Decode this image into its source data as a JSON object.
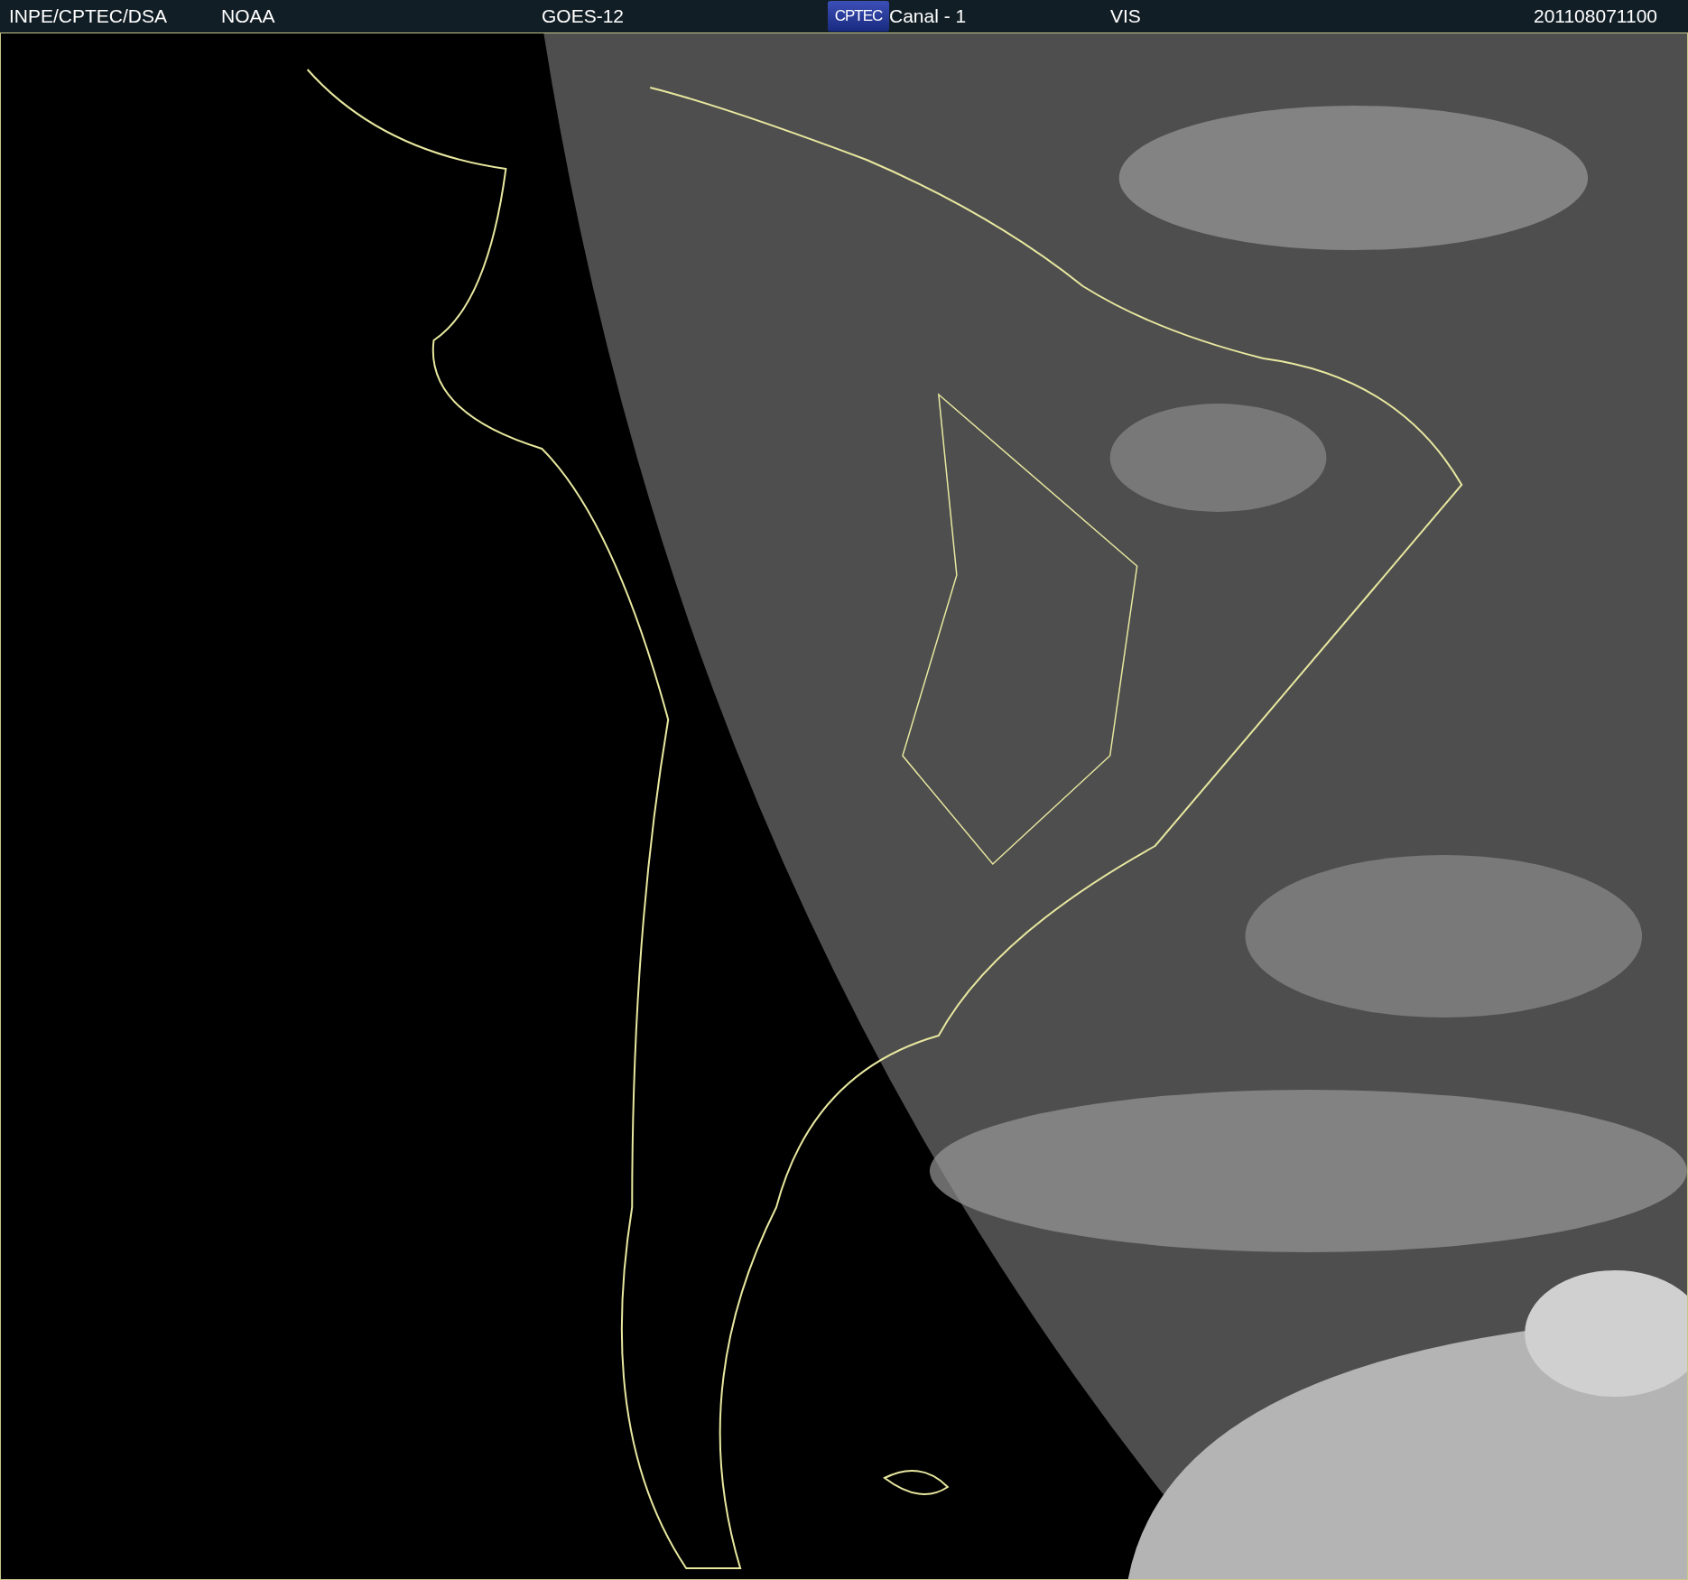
{
  "header": {
    "items": [
      {
        "kind": "text",
        "text": "INPE/CPTEC/DSA"
      },
      {
        "kind": "text",
        "text": "NOAA"
      },
      {
        "kind": "text",
        "text": "GOES-12"
      },
      {
        "kind": "logo",
        "text": "CPTEC"
      },
      {
        "kind": "text",
        "text": "Canal - 1"
      },
      {
        "kind": "text",
        "text": "VIS"
      },
      {
        "kind": "text",
        "text": "201108071100"
      }
    ]
  }
}
